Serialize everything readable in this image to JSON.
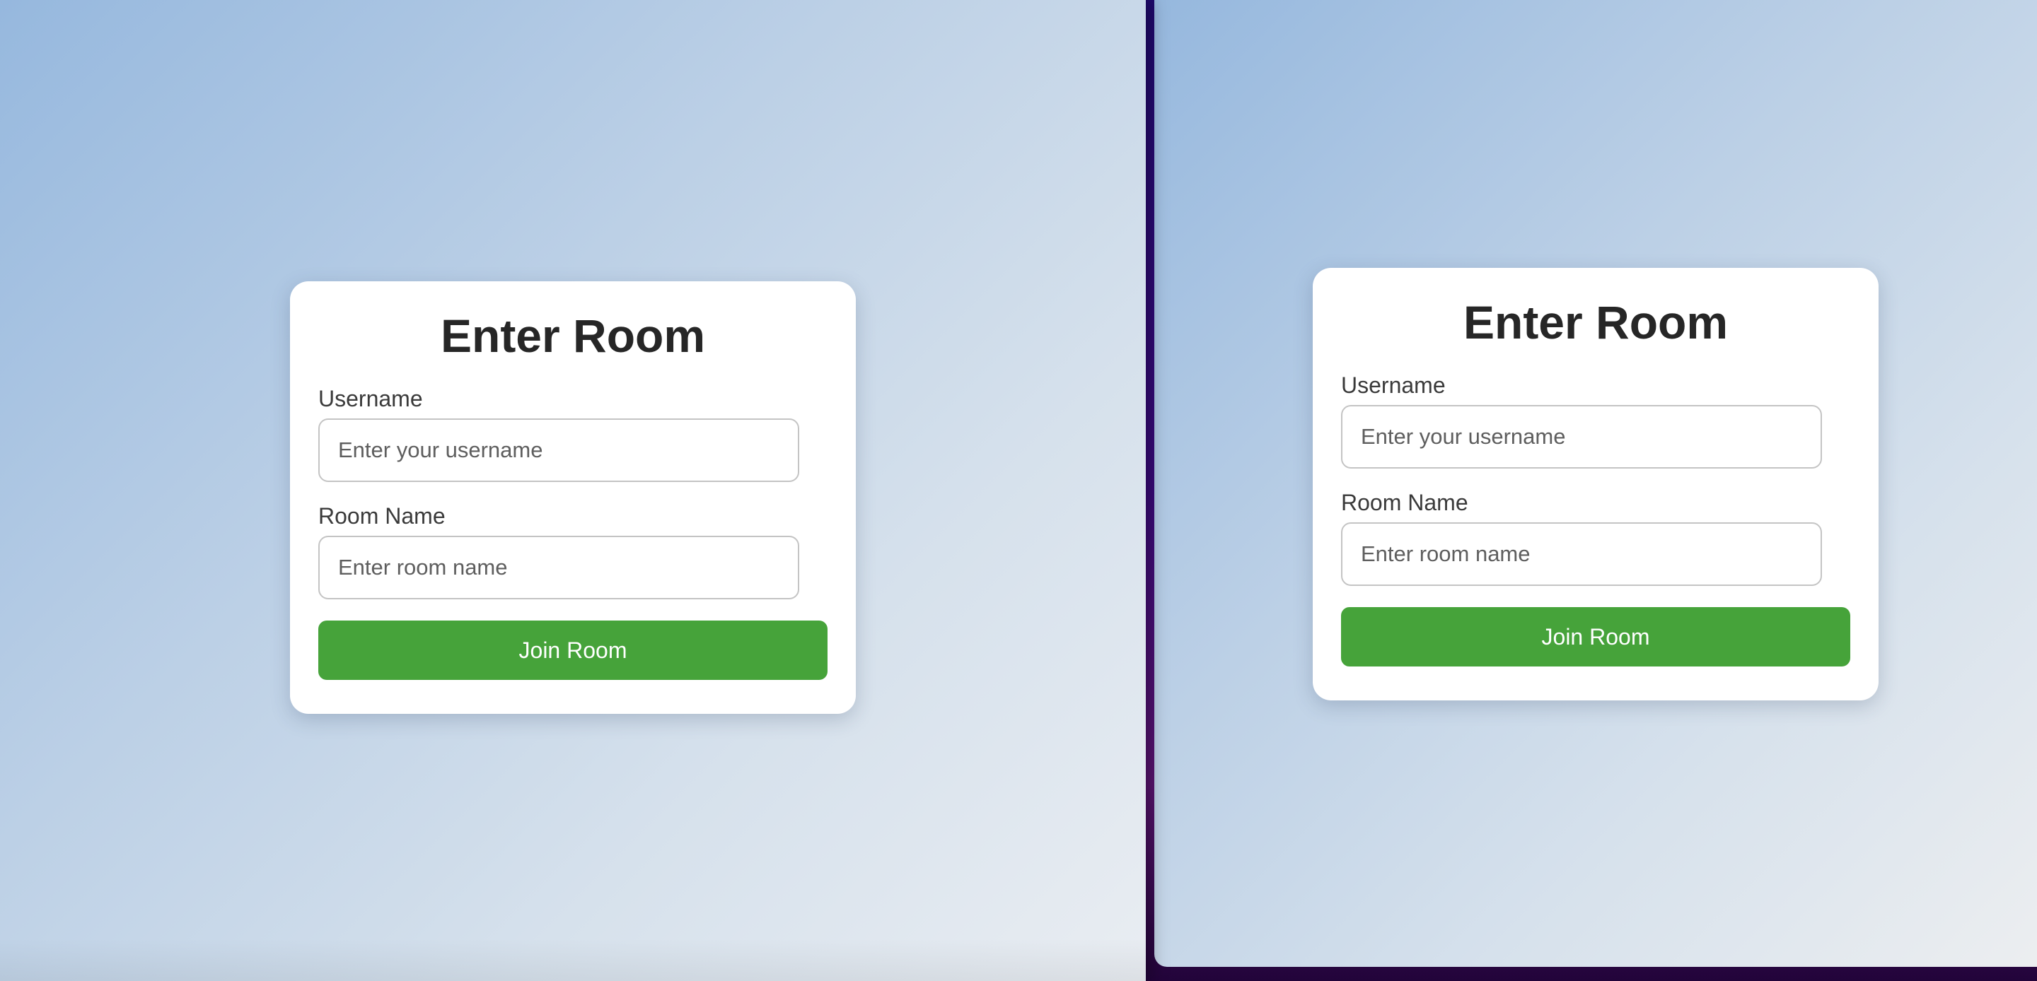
{
  "left_window": {
    "card": {
      "title": "Enter Room",
      "username_label": "Username",
      "username_placeholder": "Enter your username",
      "room_label": "Room Name",
      "room_placeholder": "Enter room name",
      "join_label": "Join Room"
    }
  },
  "right_window": {
    "card": {
      "title": "Enter Room",
      "username_label": "Username",
      "username_placeholder": "Enter your username",
      "room_label": "Room Name",
      "room_placeholder": "Enter room name",
      "join_label": "Join Room"
    }
  },
  "colors": {
    "accent_button": "#46a33a",
    "title_text": "#262626",
    "desktop_background": "#2a0a78"
  }
}
